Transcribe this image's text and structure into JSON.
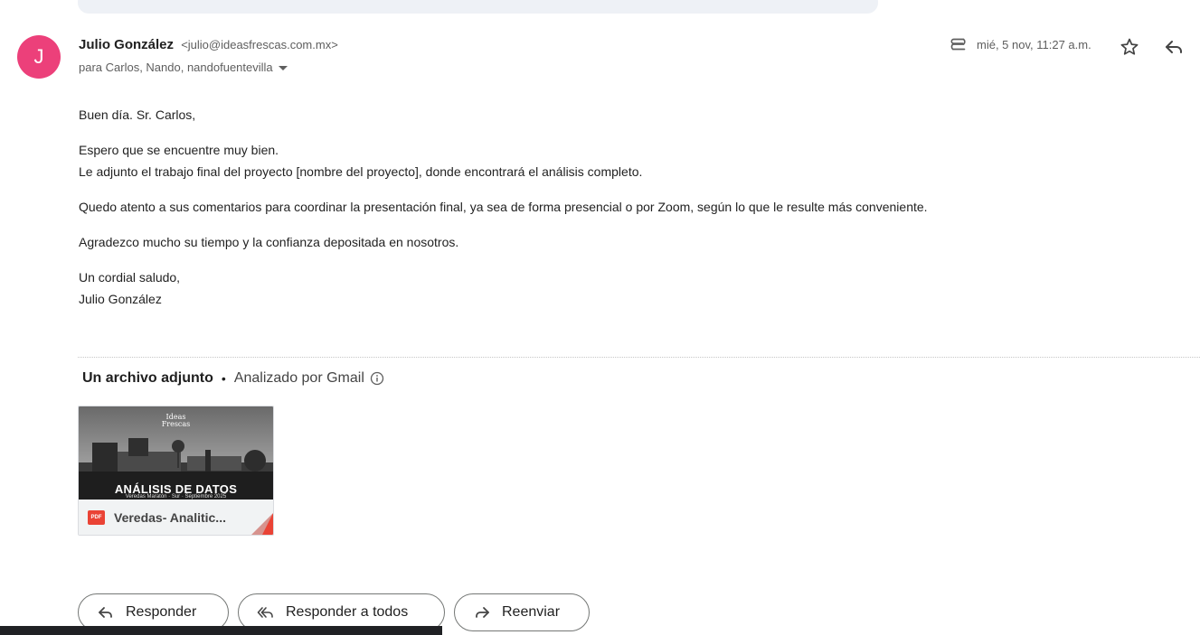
{
  "email": {
    "sender_initial": "J",
    "sender_name": "Julio González",
    "sender_email": "<julio@ideasfrescas.com.mx>",
    "recipients": "para Carlos, Nando, nandofuentevilla",
    "date": "mié, 5 nov, 11:27 a.m.",
    "body": {
      "greeting": "Buen día. Sr. Carlos,",
      "p1_line1": "Espero que se encuentre muy bien.",
      "p1_line2": "Le adjunto el trabajo final del proyecto [nombre del proyecto], donde encontrará el análisis completo.",
      "p2": "Quedo atento a sus comentarios para coordinar la presentación final, ya sea de forma presencial o por Zoom, según lo que le resulte más conveniente.",
      "p3": "Agradezco mucho su tiempo y la confianza depositada en nosotros.",
      "closing": "Un cordial saludo,",
      "signature": "Julio González"
    }
  },
  "attachments": {
    "count_label": "Un archivo adjunto",
    "separator": "•",
    "scanned_label": "Analizado por Gmail",
    "items": [
      {
        "thumb_logo_line1": "Ideas",
        "thumb_logo_line2": "Frescas",
        "thumb_title": "ANÁLISIS DE DATOS",
        "thumb_subtitle": "Veredas Maratón · Sur · Septiembre 2025",
        "file_type": "PDF",
        "file_name": "Veredas- Analitic..."
      }
    ]
  },
  "actions": {
    "reply": "Responder",
    "reply_all": "Responder a todos",
    "forward": "Reenviar"
  },
  "colors": {
    "avatar": "#ec407a",
    "pdf_red": "#ea4335"
  },
  "icons": [
    "paperclip-icon",
    "star-icon",
    "reply-icon",
    "info-icon",
    "pdf-icon",
    "forward-icon",
    "reply-all-icon",
    "dropdown-icon"
  ]
}
